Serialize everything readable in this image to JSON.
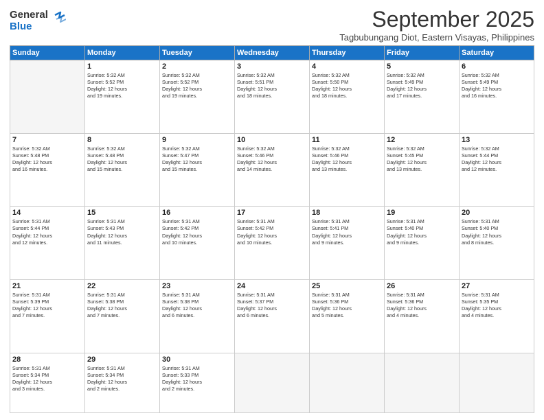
{
  "logo": {
    "line1": "General",
    "line2": "Blue"
  },
  "title": "September 2025",
  "subtitle": "Tagbubungang Diot, Eastern Visayas, Philippines",
  "days": [
    "Sunday",
    "Monday",
    "Tuesday",
    "Wednesday",
    "Thursday",
    "Friday",
    "Saturday"
  ],
  "weeks": [
    [
      {
        "num": "",
        "info": ""
      },
      {
        "num": "1",
        "info": "Sunrise: 5:32 AM\nSunset: 5:52 PM\nDaylight: 12 hours\nand 19 minutes."
      },
      {
        "num": "2",
        "info": "Sunrise: 5:32 AM\nSunset: 5:52 PM\nDaylight: 12 hours\nand 19 minutes."
      },
      {
        "num": "3",
        "info": "Sunrise: 5:32 AM\nSunset: 5:51 PM\nDaylight: 12 hours\nand 18 minutes."
      },
      {
        "num": "4",
        "info": "Sunrise: 5:32 AM\nSunset: 5:50 PM\nDaylight: 12 hours\nand 18 minutes."
      },
      {
        "num": "5",
        "info": "Sunrise: 5:32 AM\nSunset: 5:49 PM\nDaylight: 12 hours\nand 17 minutes."
      },
      {
        "num": "6",
        "info": "Sunrise: 5:32 AM\nSunset: 5:49 PM\nDaylight: 12 hours\nand 16 minutes."
      }
    ],
    [
      {
        "num": "7",
        "info": "Sunrise: 5:32 AM\nSunset: 5:48 PM\nDaylight: 12 hours\nand 16 minutes."
      },
      {
        "num": "8",
        "info": "Sunrise: 5:32 AM\nSunset: 5:48 PM\nDaylight: 12 hours\nand 15 minutes."
      },
      {
        "num": "9",
        "info": "Sunrise: 5:32 AM\nSunset: 5:47 PM\nDaylight: 12 hours\nand 15 minutes."
      },
      {
        "num": "10",
        "info": "Sunrise: 5:32 AM\nSunset: 5:46 PM\nDaylight: 12 hours\nand 14 minutes."
      },
      {
        "num": "11",
        "info": "Sunrise: 5:32 AM\nSunset: 5:46 PM\nDaylight: 12 hours\nand 13 minutes."
      },
      {
        "num": "12",
        "info": "Sunrise: 5:32 AM\nSunset: 5:45 PM\nDaylight: 12 hours\nand 13 minutes."
      },
      {
        "num": "13",
        "info": "Sunrise: 5:32 AM\nSunset: 5:44 PM\nDaylight: 12 hours\nand 12 minutes."
      }
    ],
    [
      {
        "num": "14",
        "info": "Sunrise: 5:31 AM\nSunset: 5:44 PM\nDaylight: 12 hours\nand 12 minutes."
      },
      {
        "num": "15",
        "info": "Sunrise: 5:31 AM\nSunset: 5:43 PM\nDaylight: 12 hours\nand 11 minutes."
      },
      {
        "num": "16",
        "info": "Sunrise: 5:31 AM\nSunset: 5:42 PM\nDaylight: 12 hours\nand 10 minutes."
      },
      {
        "num": "17",
        "info": "Sunrise: 5:31 AM\nSunset: 5:42 PM\nDaylight: 12 hours\nand 10 minutes."
      },
      {
        "num": "18",
        "info": "Sunrise: 5:31 AM\nSunset: 5:41 PM\nDaylight: 12 hours\nand 9 minutes."
      },
      {
        "num": "19",
        "info": "Sunrise: 5:31 AM\nSunset: 5:40 PM\nDaylight: 12 hours\nand 9 minutes."
      },
      {
        "num": "20",
        "info": "Sunrise: 5:31 AM\nSunset: 5:40 PM\nDaylight: 12 hours\nand 8 minutes."
      }
    ],
    [
      {
        "num": "21",
        "info": "Sunrise: 5:31 AM\nSunset: 5:39 PM\nDaylight: 12 hours\nand 7 minutes."
      },
      {
        "num": "22",
        "info": "Sunrise: 5:31 AM\nSunset: 5:38 PM\nDaylight: 12 hours\nand 7 minutes."
      },
      {
        "num": "23",
        "info": "Sunrise: 5:31 AM\nSunset: 5:38 PM\nDaylight: 12 hours\nand 6 minutes."
      },
      {
        "num": "24",
        "info": "Sunrise: 5:31 AM\nSunset: 5:37 PM\nDaylight: 12 hours\nand 6 minutes."
      },
      {
        "num": "25",
        "info": "Sunrise: 5:31 AM\nSunset: 5:36 PM\nDaylight: 12 hours\nand 5 minutes."
      },
      {
        "num": "26",
        "info": "Sunrise: 5:31 AM\nSunset: 5:36 PM\nDaylight: 12 hours\nand 4 minutes."
      },
      {
        "num": "27",
        "info": "Sunrise: 5:31 AM\nSunset: 5:35 PM\nDaylight: 12 hours\nand 4 minutes."
      }
    ],
    [
      {
        "num": "28",
        "info": "Sunrise: 5:31 AM\nSunset: 5:34 PM\nDaylight: 12 hours\nand 3 minutes."
      },
      {
        "num": "29",
        "info": "Sunrise: 5:31 AM\nSunset: 5:34 PM\nDaylight: 12 hours\nand 2 minutes."
      },
      {
        "num": "30",
        "info": "Sunrise: 5:31 AM\nSunset: 5:33 PM\nDaylight: 12 hours\nand 2 minutes."
      },
      {
        "num": "",
        "info": ""
      },
      {
        "num": "",
        "info": ""
      },
      {
        "num": "",
        "info": ""
      },
      {
        "num": "",
        "info": ""
      }
    ]
  ]
}
